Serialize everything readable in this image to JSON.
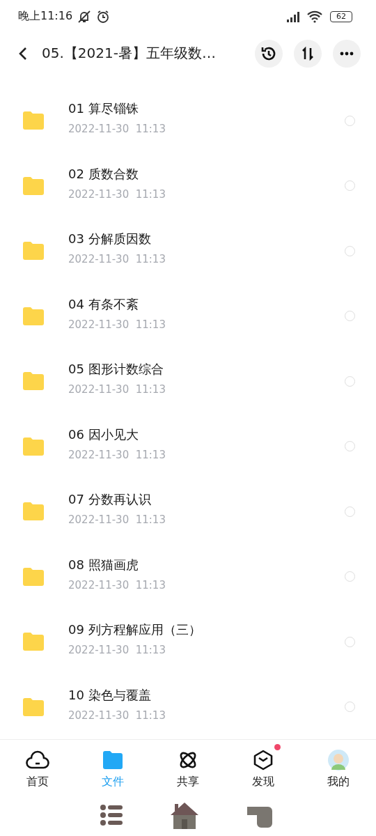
{
  "status_bar": {
    "time": "晚上11:16",
    "battery": "62"
  },
  "header": {
    "title": "05.【2021-暑】五年级数…"
  },
  "files": [
    {
      "name": "01 算尽锱铢",
      "date": "2022-11-30  11:13",
      "selected": false
    },
    {
      "name": "02 质数合数",
      "date": "2022-11-30  11:13",
      "selected": false
    },
    {
      "name": "03 分解质因数",
      "date": "2022-11-30  11:13",
      "selected": false
    },
    {
      "name": "04 有条不紊",
      "date": "2022-11-30  11:13",
      "selected": false
    },
    {
      "name": "05 图形计数综合",
      "date": "2022-11-30  11:13",
      "selected": false
    },
    {
      "name": "06 因小见大",
      "date": "2022-11-30  11:13",
      "selected": false
    },
    {
      "name": "07 分数再认识",
      "date": "2022-11-30  11:13",
      "selected": false
    },
    {
      "name": "08 照猫画虎",
      "date": "2022-11-30  11:13",
      "selected": false
    },
    {
      "name": "09 列方程解应用（三）",
      "date": "2022-11-30  11:13",
      "selected": false
    },
    {
      "name": "10 染色与覆盖",
      "date": "2022-11-30  11:13",
      "selected": false
    }
  ],
  "tabs": [
    {
      "kind": "home",
      "label": "首页",
      "selected": false,
      "dot": false
    },
    {
      "kind": "files",
      "label": "文件",
      "selected": true,
      "dot": false
    },
    {
      "kind": "share",
      "label": "共享",
      "selected": false,
      "dot": false
    },
    {
      "kind": "discover",
      "label": "发现",
      "selected": false,
      "dot": true
    },
    {
      "kind": "me",
      "label": "我的",
      "selected": false,
      "dot": false
    }
  ]
}
